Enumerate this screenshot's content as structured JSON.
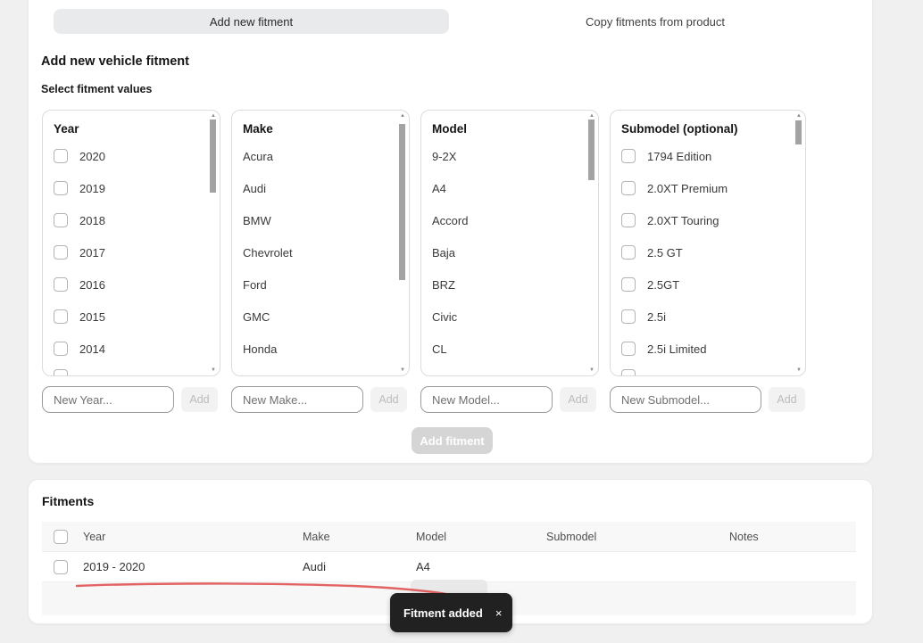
{
  "tabs": [
    {
      "label": "Add new fitment",
      "active": true
    },
    {
      "label": "Copy fitments from product",
      "active": false
    }
  ],
  "section": {
    "title": "Add new vehicle fitment",
    "subtitle": "Select fitment values"
  },
  "columns": [
    {
      "header": "Year",
      "has_checkboxes": true,
      "partial_item_visible": true,
      "items": [
        "2020",
        "2019",
        "2018",
        "2017",
        "2016",
        "2015",
        "2014"
      ],
      "new_placeholder": "New Year...",
      "add_label": "Add"
    },
    {
      "header": "Make",
      "has_checkboxes": false,
      "partial_item_visible": false,
      "items": [
        "Acura",
        "Audi",
        "BMW",
        "Chevrolet",
        "Ford",
        "GMC",
        "Honda"
      ],
      "new_placeholder": "New Make...",
      "add_label": "Add"
    },
    {
      "header": "Model",
      "has_checkboxes": false,
      "partial_item_visible": false,
      "items": [
        "9-2X",
        "A4",
        "Accord",
        "Baja",
        "BRZ",
        "Civic",
        "CL"
      ],
      "new_placeholder": "New Model...",
      "add_label": "Add"
    },
    {
      "header": "Submodel (optional)",
      "has_checkboxes": true,
      "partial_item_visible": true,
      "items": [
        "1794 Edition",
        "2.0XT Premium",
        "2.0XT Touring",
        "2.5 GT",
        "2.5GT",
        "2.5i",
        "2.5i Limited"
      ],
      "new_placeholder": "New Submodel...",
      "add_label": "Add"
    }
  ],
  "add_fitment_label": "Add fitment",
  "fitments": {
    "title": "Fitments",
    "table": {
      "headers": [
        "Year",
        "Make",
        "Model",
        "Submodel",
        "Notes"
      ],
      "rows": [
        {
          "year": "2019 - 2020",
          "make": "Audi",
          "model": "A4",
          "submodel": "",
          "notes": ""
        }
      ]
    }
  },
  "toast": {
    "message": "Fitment added",
    "close": "×",
    "background": "#212121"
  },
  "annotation": {
    "color": "#e15b5b"
  },
  "colors": {
    "page_background": "#f0f0f1",
    "active_tab": "#e9eaeb",
    "disabled_button": "#d5d5d5"
  }
}
